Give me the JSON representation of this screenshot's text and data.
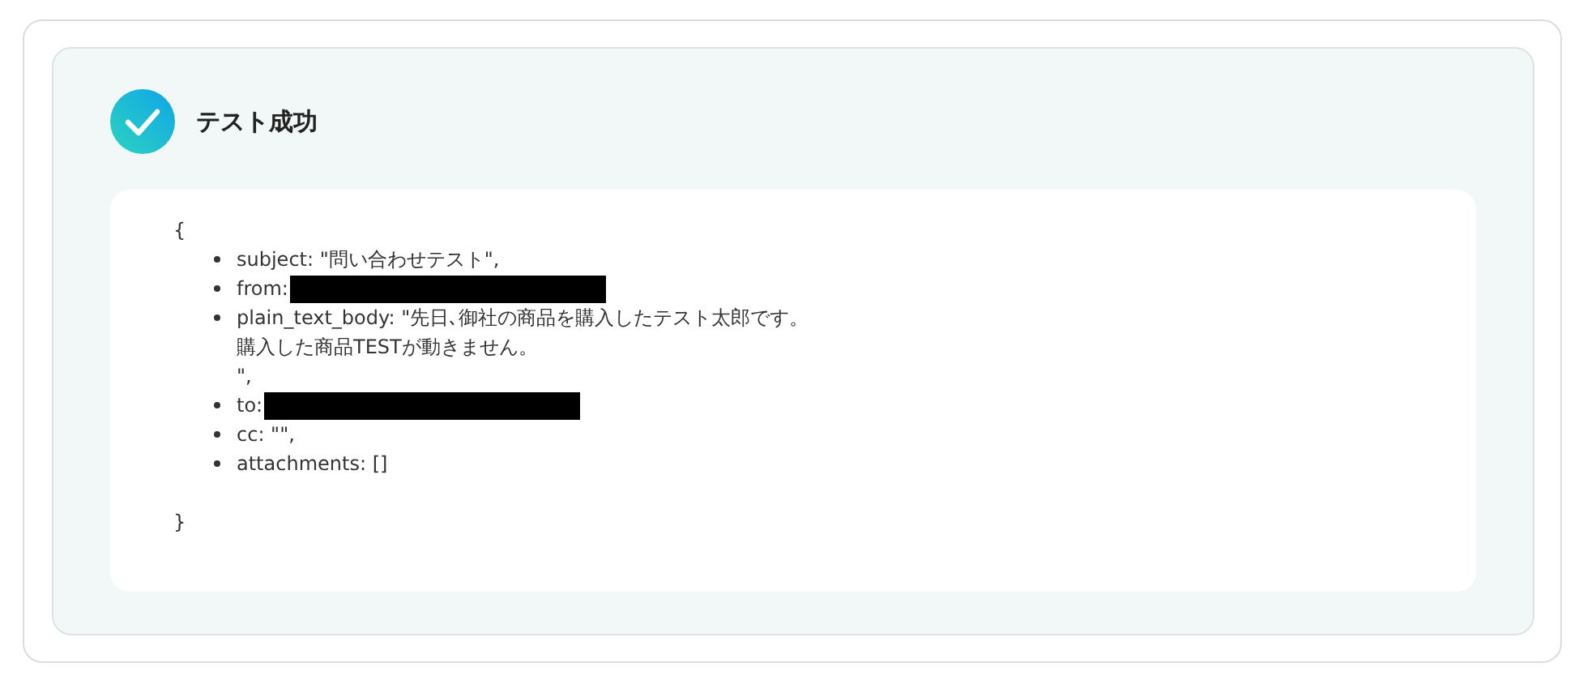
{
  "result": {
    "title": "テスト成功"
  },
  "output": {
    "open_brace": "{",
    "close_brace": "}",
    "items": [
      {
        "lines": [
          "subject: \"問い合わせテスト\","
        ],
        "redacted": false
      },
      {
        "lines": [
          "from:"
        ],
        "redacted": true
      },
      {
        "lines": [
          "plain_text_body: \"先日､御社の商品を購入したテスト太郎です。",
          "購入した商品TESTが動きません。",
          "\","
        ],
        "redacted": false
      },
      {
        "lines": [
          "to:"
        ],
        "redacted": true
      },
      {
        "lines": [
          "cc: \"\","
        ],
        "redacted": false
      },
      {
        "lines": [
          "attachments: []"
        ],
        "redacted": false
      }
    ]
  }
}
